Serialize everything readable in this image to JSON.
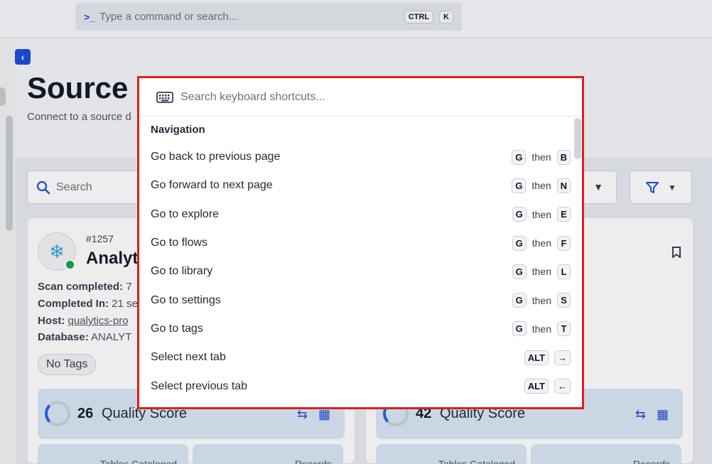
{
  "topbar": {
    "command_placeholder": "Type a command or search...",
    "shortcut_keys": [
      "CTRL",
      "K"
    ]
  },
  "page": {
    "title": "Source D",
    "subtitle": "Connect to a source d"
  },
  "toolbar": {
    "search_label": "Search"
  },
  "cards": [
    {
      "id": "#1257",
      "name": "Analyt",
      "scan_label": "Scan completed:",
      "scan_value": "7",
      "completed_label": "Completed In:",
      "completed_value": "21 se",
      "host_label": "Host:",
      "host_value": "qualytics-pro",
      "database_label": "Database:",
      "database_value": "ANALYT",
      "tag": "No Tags",
      "quality_score": "26",
      "quality_label": "Quality Score",
      "tile_tables": "Tables Cataloged",
      "tile_records": "Records"
    },
    {
      "quality_score": "42",
      "quality_label": "Quality Score",
      "tile_tables": "Tables Cataloged",
      "tile_records": "Records"
    }
  ],
  "modal": {
    "search_placeholder": "Search keyboard shortcuts...",
    "section_title": "Navigation",
    "then_word": "then",
    "shortcuts": [
      {
        "label": "Go back to previous page",
        "k1": "G",
        "sep": "then",
        "k2": "B"
      },
      {
        "label": "Go forward to next page",
        "k1": "G",
        "sep": "then",
        "k2": "N"
      },
      {
        "label": "Go to explore",
        "k1": "G",
        "sep": "then",
        "k2": "E"
      },
      {
        "label": "Go to flows",
        "k1": "G",
        "sep": "then",
        "k2": "F"
      },
      {
        "label": "Go to library",
        "k1": "G",
        "sep": "then",
        "k2": "L"
      },
      {
        "label": "Go to settings",
        "k1": "G",
        "sep": "then",
        "k2": "S"
      },
      {
        "label": "Go to tags",
        "k1": "G",
        "sep": "then",
        "k2": "T"
      },
      {
        "label": "Select next tab",
        "k1": "ALT",
        "sep": "",
        "k2": "→"
      },
      {
        "label": "Select previous tab",
        "k1": "ALT",
        "sep": "",
        "k2": "←"
      }
    ]
  },
  "colors": {
    "accent": "#1d4ed8",
    "highlight_border": "#e01e1e",
    "status_online": "#16a34a"
  },
  "icons": [
    "terminal-icon",
    "chevron-left-icon",
    "search-icon",
    "chevron-down-icon",
    "filter-icon",
    "snowflake-icon",
    "bookmark-icon",
    "keyboard-icon",
    "database-sync-icon",
    "calendar-icon"
  ]
}
